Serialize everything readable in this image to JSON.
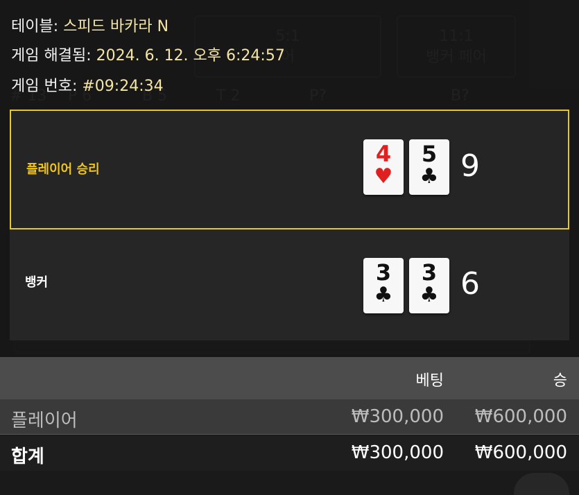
{
  "info": {
    "table_label": "테이블:",
    "table_value": "스피드 바카라 N",
    "resolved_label": "게임 해결됨:",
    "resolved_value": "2024. 6. 12. 오후 6:24:57",
    "number_label": "게임 번호:",
    "number_value": "#09:24:34"
  },
  "background": {
    "bet_boxes": [
      {
        "odds": "5:1",
        "label": "어"
      },
      {
        "odds": "11:1",
        "label": "뱅커 페어"
      }
    ],
    "stats": [
      "# 13",
      "P 6",
      "B 5",
      "T 2",
      "P?",
      "B?"
    ]
  },
  "hands": {
    "player": {
      "label": "플레이어 승리",
      "cards": [
        {
          "rank": "4",
          "suit": "♥",
          "color": "red"
        },
        {
          "rank": "5",
          "suit": "♣",
          "color": "black"
        }
      ],
      "score": "9"
    },
    "banker": {
      "label": "뱅커",
      "cards": [
        {
          "rank": "3",
          "suit": "♣",
          "color": "black"
        },
        {
          "rank": "3",
          "suit": "♣",
          "color": "black"
        }
      ],
      "score": "6"
    }
  },
  "summary": {
    "headers": {
      "bet": "베팅",
      "win": "승"
    },
    "rows": [
      {
        "name": "플레이어",
        "bet": "₩300,000",
        "win": "₩600,000"
      }
    ],
    "total": {
      "name": "합계",
      "bet": "₩300,000",
      "win": "₩600,000"
    }
  },
  "colors": {
    "winner_accent": "#e6c82a",
    "header_value": "#f5e6a6"
  }
}
